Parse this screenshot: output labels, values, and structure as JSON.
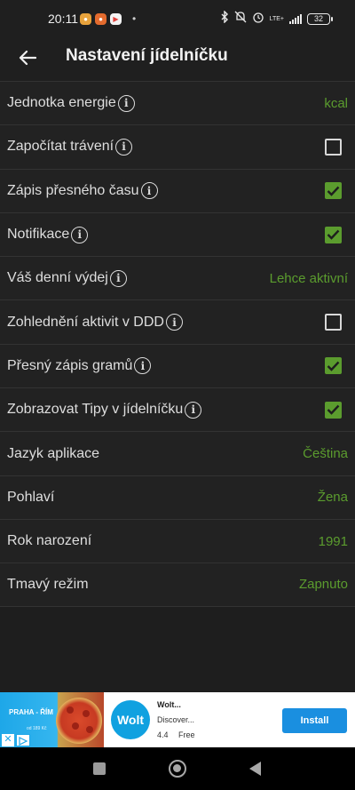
{
  "status_bar": {
    "time": "20:11",
    "network": "LTE+",
    "battery": "32"
  },
  "header": {
    "title": "Nastavení jídelníčku"
  },
  "settings": [
    {
      "label": "Jednotka energie",
      "info": true,
      "type": "value",
      "value": "kcal"
    },
    {
      "label": "Započítat trávení",
      "info": true,
      "type": "checkbox",
      "checked": false
    },
    {
      "label": "Zápis přesného času",
      "info": true,
      "type": "checkbox",
      "checked": true
    },
    {
      "label": "Notifikace",
      "info": true,
      "type": "checkbox",
      "checked": true
    },
    {
      "label": "Váš denní výdej",
      "info": true,
      "type": "value",
      "value": "Lehce aktivní"
    },
    {
      "label": "Zohlednění aktivit v DDD",
      "info": true,
      "type": "checkbox",
      "checked": false
    },
    {
      "label": "Přesný zápis gramů",
      "info": true,
      "type": "checkbox",
      "checked": true
    },
    {
      "label": "Zobrazovat Tipy v jídelníčku",
      "info": true,
      "type": "checkbox",
      "checked": true
    },
    {
      "label": "Jazyk aplikace",
      "info": false,
      "type": "value",
      "value": "Čeština"
    },
    {
      "label": "Pohlaví",
      "info": false,
      "type": "value",
      "value": "Žena"
    },
    {
      "label": "Rok narození",
      "info": false,
      "type": "value",
      "value": "1991"
    },
    {
      "label": "Tmavý režim",
      "info": false,
      "type": "value",
      "value": "Zapnuto"
    }
  ],
  "ad": {
    "image_text": "PRAHA - ŘÍM",
    "image_price": "od 189 Kč",
    "logo": "Wolt",
    "name": "Wolt...",
    "description": "Discover...",
    "rating": "4.4",
    "price": "Free",
    "install_label": "Install"
  },
  "colors": {
    "accent": "#5b9c2e",
    "background": "#1e1e1e",
    "row_background": "#222222"
  }
}
